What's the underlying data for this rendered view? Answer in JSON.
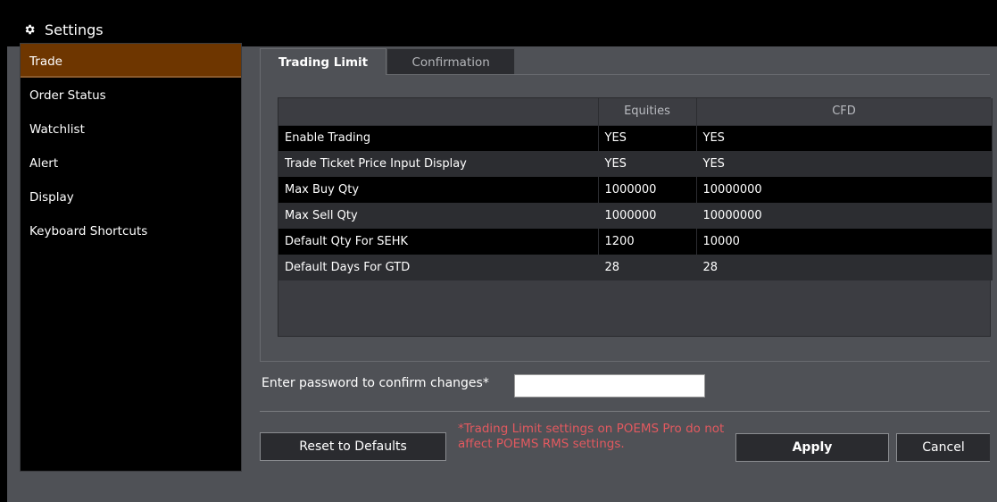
{
  "window": {
    "title": "Settings"
  },
  "sidebar": {
    "items": [
      {
        "label": "Trade",
        "active": true
      },
      {
        "label": "Order Status"
      },
      {
        "label": "Watchlist"
      },
      {
        "label": "Alert"
      },
      {
        "label": "Display"
      },
      {
        "label": "Keyboard Shortcuts"
      }
    ]
  },
  "tabs": [
    {
      "label": "Trading Limit",
      "active": true
    },
    {
      "label": "Confirmation"
    }
  ],
  "table": {
    "columns": [
      "",
      "Equities",
      "CFD"
    ],
    "rows": [
      {
        "label": "Enable Trading",
        "equities": "YES",
        "cfd": "YES"
      },
      {
        "label": "Trade Ticket Price Input Display",
        "equities": "YES",
        "cfd": "YES"
      },
      {
        "label": "Max Buy Qty",
        "equities": "1000000",
        "cfd": "10000000"
      },
      {
        "label": "Max Sell Qty",
        "equities": "1000000",
        "cfd": "10000000"
      },
      {
        "label": "Default Qty For SEHK",
        "equities": "1200",
        "cfd": "10000"
      },
      {
        "label": "Default Days For GTD",
        "equities": "28",
        "cfd": "28"
      }
    ]
  },
  "password": {
    "label": "Enter password to confirm changes*",
    "value": ""
  },
  "footer": {
    "reset_label": "Reset to Defaults",
    "note": "*Trading Limit settings on POEMS Pro do not affect POEMS RMS settings.",
    "apply_label": "Apply",
    "cancel_label": "Cancel"
  },
  "colors": {
    "accent": "#6e3600",
    "note": "#e2595f",
    "background": "#4f5156"
  }
}
